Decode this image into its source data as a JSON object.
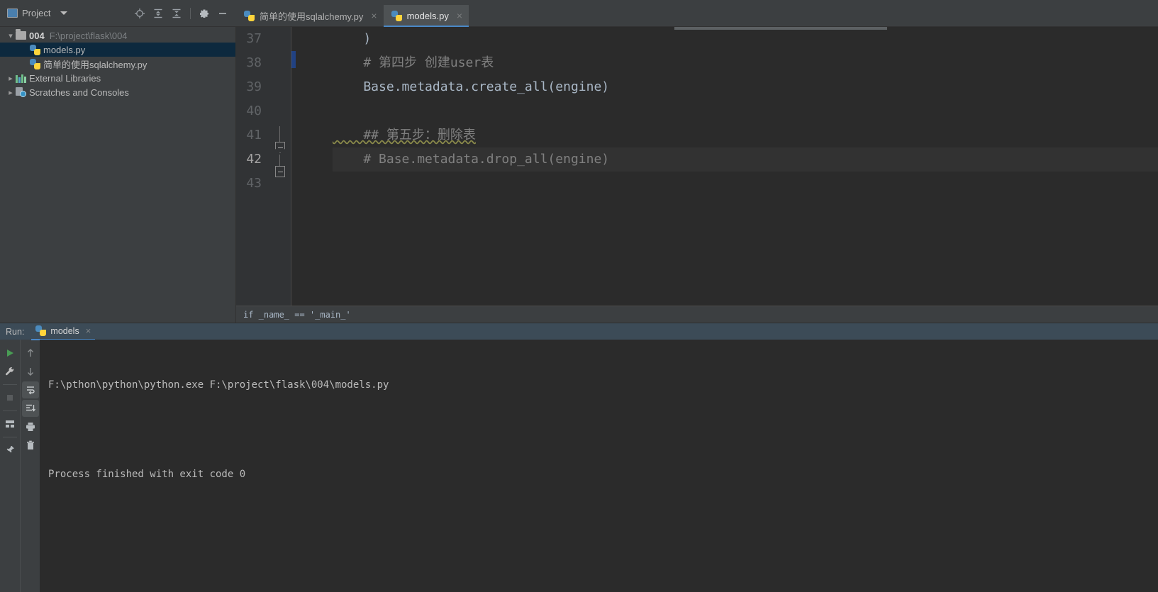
{
  "project_panel": {
    "title": "Project",
    "icons": [
      {
        "name": "locate-icon",
        "glyph": "target"
      },
      {
        "name": "expand-all-icon",
        "glyph": "expand"
      },
      {
        "name": "collapse-all-icon",
        "glyph": "collapse"
      },
      {
        "name": "settings-gear-icon",
        "glyph": "gear"
      },
      {
        "name": "hide-panel-icon",
        "glyph": "minus"
      }
    ],
    "tree": [
      {
        "label": "004",
        "path_hint": "F:\\project\\flask\\004",
        "icon": "folder-icon",
        "expanded": true,
        "indent": 0,
        "selected": false
      },
      {
        "label": "models.py",
        "path_hint": "",
        "icon": "python-file-icon",
        "expanded": null,
        "indent": 1,
        "selected": true
      },
      {
        "label": "简单的使用sqlalchemy.py",
        "path_hint": "",
        "icon": "python-file-icon",
        "expanded": null,
        "indent": 1,
        "selected": false
      },
      {
        "label": "External Libraries",
        "path_hint": "",
        "icon": "library-icon",
        "expanded": false,
        "indent": 0,
        "selected": false
      },
      {
        "label": "Scratches and Consoles",
        "path_hint": "",
        "icon": "scratches-icon",
        "expanded": false,
        "indent": 0,
        "selected": false
      }
    ]
  },
  "editor": {
    "tabs": [
      {
        "label": "简单的使用sqlalchemy.py",
        "active": false,
        "close": "×"
      },
      {
        "label": "models.py",
        "active": true,
        "close": "×"
      }
    ],
    "lines": [
      {
        "number": "37",
        "segments": [
          {
            "text": "    )",
            "cls": "plain"
          }
        ],
        "current": false,
        "highlighted": false
      },
      {
        "number": "38",
        "segments": [
          {
            "text": "    # 第四步 创建user表",
            "cls": "comment"
          }
        ],
        "current": false,
        "highlighted": false
      },
      {
        "number": "39",
        "segments": [
          {
            "text": "    Base.metadata.create_all(engine)",
            "cls": "plain"
          }
        ],
        "current": false,
        "highlighted": false
      },
      {
        "number": "40",
        "segments": [
          {
            "text": "",
            "cls": "plain"
          }
        ],
        "current": false,
        "highlighted": false
      },
      {
        "number": "41",
        "segments": [
          {
            "text": "    ## 第五步：删除表",
            "cls": "comment-wavy"
          }
        ],
        "current": false,
        "highlighted": false
      },
      {
        "number": "42",
        "segments": [
          {
            "text": "    # Base.metadata.drop_all(engine)",
            "cls": "comment"
          }
        ],
        "current": true,
        "highlighted": true
      },
      {
        "number": "43",
        "segments": [
          {
            "text": "",
            "cls": "plain"
          }
        ],
        "current": false,
        "highlighted": false
      }
    ],
    "breadcrumb": "if _name_ == '_main_'"
  },
  "run_panel": {
    "label": "Run:",
    "tab_label": "models",
    "tab_close": "×",
    "toolbar_left": [
      {
        "name": "rerun-icon",
        "glyph": "play"
      },
      {
        "name": "edit-configuration-icon",
        "glyph": "wrench"
      },
      {
        "name": "stop-icon",
        "glyph": "square"
      },
      {
        "name": "layout-icon",
        "glyph": "layout"
      },
      {
        "name": "pin-tab-icon",
        "glyph": "pin"
      }
    ],
    "toolbar_right": [
      {
        "name": "up-the-stack-icon",
        "glyph": "up"
      },
      {
        "name": "down-the-stack-icon",
        "glyph": "down"
      },
      {
        "name": "soft-wrap-icon",
        "glyph": "wrap",
        "active": true
      },
      {
        "name": "scroll-to-end-icon",
        "glyph": "scrollend",
        "active": true
      },
      {
        "name": "print-icon",
        "glyph": "print"
      },
      {
        "name": "clear-all-icon",
        "glyph": "trash"
      }
    ],
    "console_lines": [
      "F:\\pthon\\python\\python.exe F:\\project\\flask\\004\\models.py",
      "",
      "Process finished with exit code 0"
    ]
  },
  "colors": {
    "background": "#3c3f41",
    "editor_bg": "#2b2b2b",
    "gutter_bg": "#313335",
    "accent_blue": "#4a88c7",
    "selection_navy": "#0d293e",
    "run_header": "#3c4b57",
    "text": "#bbbbbb",
    "comment": "#808080",
    "code_text": "#a9b7c6"
  }
}
